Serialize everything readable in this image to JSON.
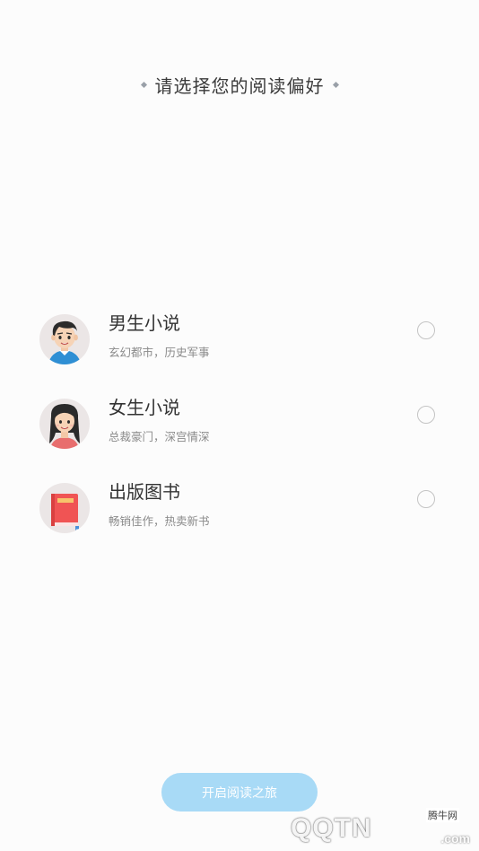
{
  "header": {
    "title": "请选择您的阅读偏好"
  },
  "options": [
    {
      "title": "男生小说",
      "description": "玄幻都市，历史军事",
      "icon": "boy-avatar-icon",
      "selected": false
    },
    {
      "title": "女生小说",
      "description": "总裁豪门，深宫情深",
      "icon": "girl-avatar-icon",
      "selected": false
    },
    {
      "title": "出版图书",
      "description": "畅销佳作，热卖新书",
      "icon": "book-icon",
      "selected": false
    }
  ],
  "start_button": {
    "label": "开启阅读之旅"
  },
  "watermark": {
    "site_name": "腾牛网",
    "logo_text": "QQTN",
    "logo_suffix": ".com"
  },
  "colors": {
    "background": "#fcfcfc",
    "button": "#a8daf6",
    "title_text": "#333333",
    "desc_text": "#8a8a8a",
    "radio_border": "#c4c4c4"
  }
}
